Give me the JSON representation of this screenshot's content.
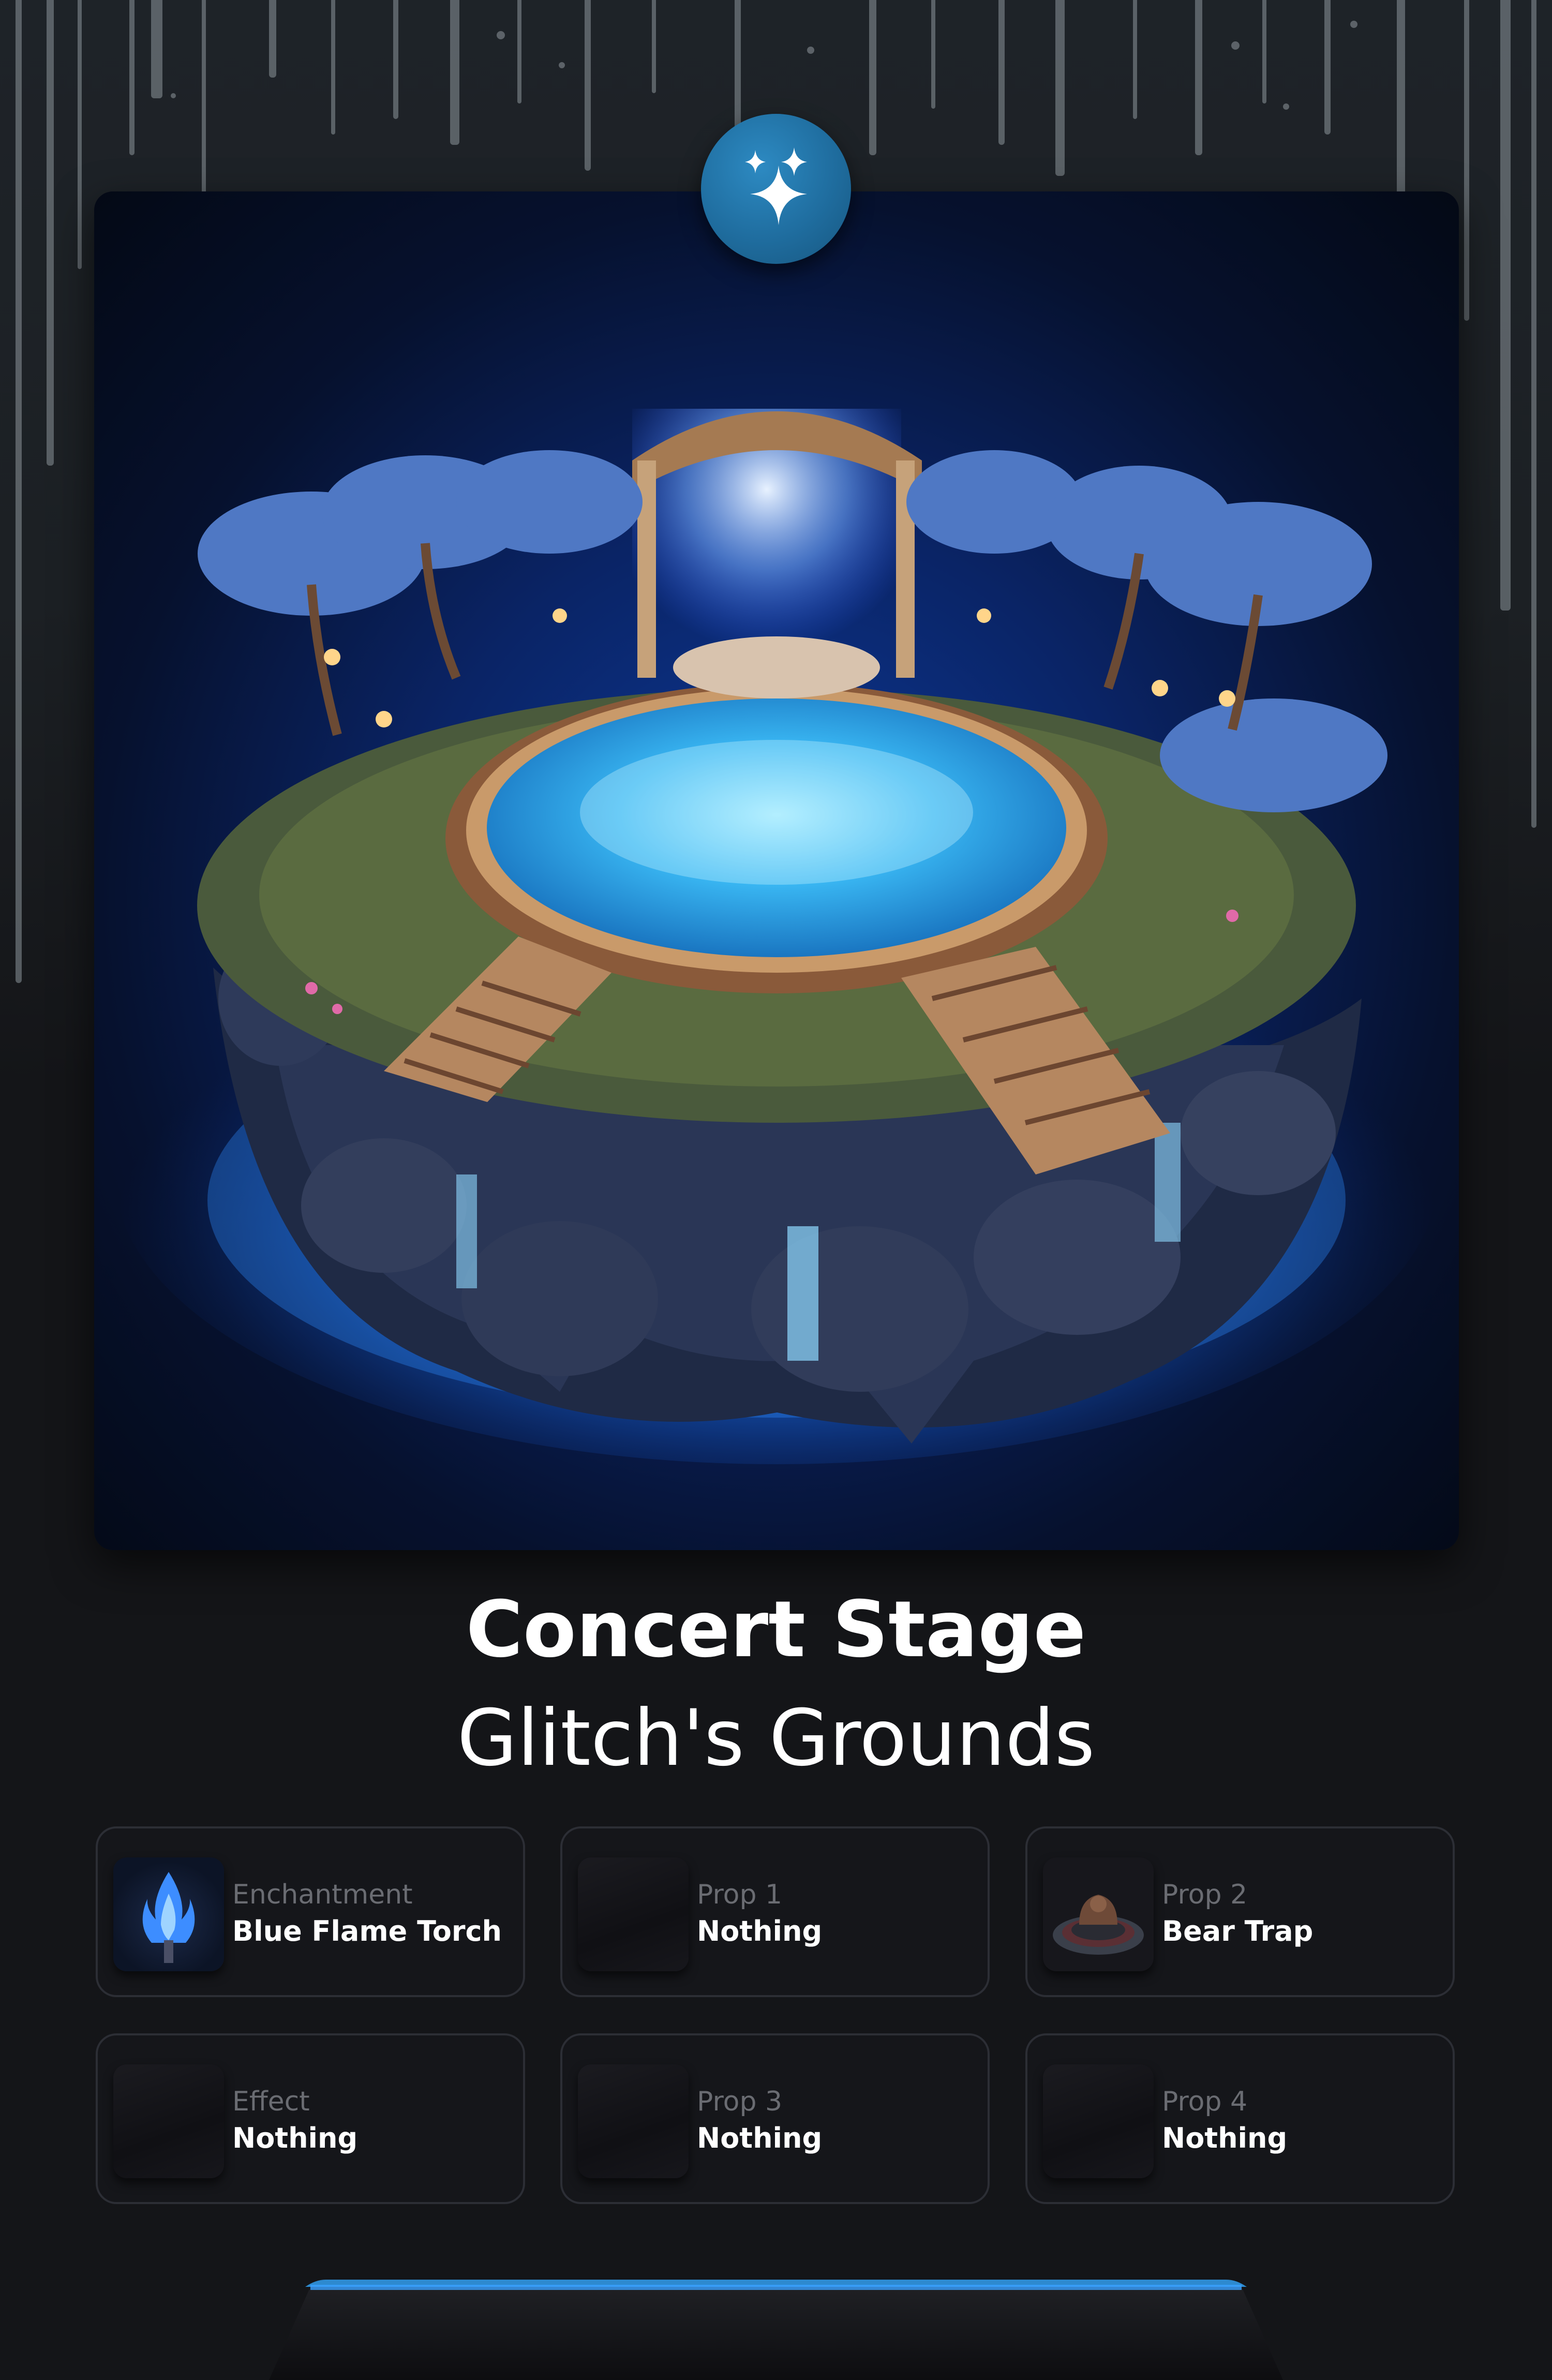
{
  "location": {
    "title": "Concert Stage",
    "subtitle": "Glitch's Grounds"
  },
  "slots": [
    {
      "label": "Enchantment",
      "value": "Blue Flame Torch",
      "icon": "blue-flame-torch-icon"
    },
    {
      "label": "Prop 1",
      "value": "Nothing",
      "icon": "empty-slot-icon"
    },
    {
      "label": "Prop 2",
      "value": "Bear Trap",
      "icon": "bear-trap-icon"
    },
    {
      "label": "Effect",
      "value": "Nothing",
      "icon": "empty-slot-icon"
    },
    {
      "label": "Prop 3",
      "value": "Nothing",
      "icon": "empty-slot-icon"
    },
    {
      "label": "Prop 4",
      "value": "Nothing",
      "icon": "empty-slot-icon"
    }
  ],
  "colors": {
    "accent": "#1f6d9f",
    "background": "#141518",
    "glow": "#3aa0ff"
  }
}
